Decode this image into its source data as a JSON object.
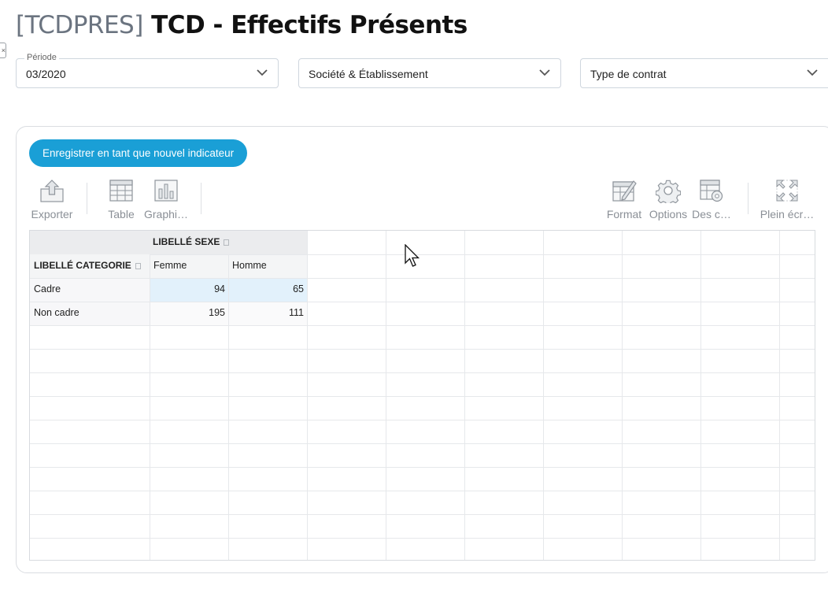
{
  "header": {
    "code": "[TCDPRES]",
    "title": "TCD - Effectifs Présents"
  },
  "filters": [
    {
      "label": "Période",
      "value": "03/2020"
    },
    {
      "label": "",
      "value": "Société & Établissement"
    },
    {
      "label": "",
      "value": "Type de contrat"
    }
  ],
  "save_button": "Enregistrer en tant que nouvel indicateur",
  "toolbar": {
    "export": "Exporter",
    "table": "Table",
    "chart": "Graphi…",
    "format": "Format",
    "options": "Options",
    "fields": "Des c…",
    "fullscreen": "Plein écr…"
  },
  "pivot": {
    "column_field": "LIBELLÉ SEXE",
    "row_field": "LIBELLÉ CATEGORIE",
    "columns": [
      "Femme",
      "Homme"
    ],
    "rows": [
      {
        "label": "Cadre",
        "values": [
          "94",
          "65"
        ]
      },
      {
        "label": "Non cadre",
        "values": [
          "195",
          "111"
        ]
      }
    ]
  },
  "colors": {
    "accent": "#1a9fd6",
    "highlight": "#e2f1fb",
    "header_bg": "#ebecee"
  }
}
